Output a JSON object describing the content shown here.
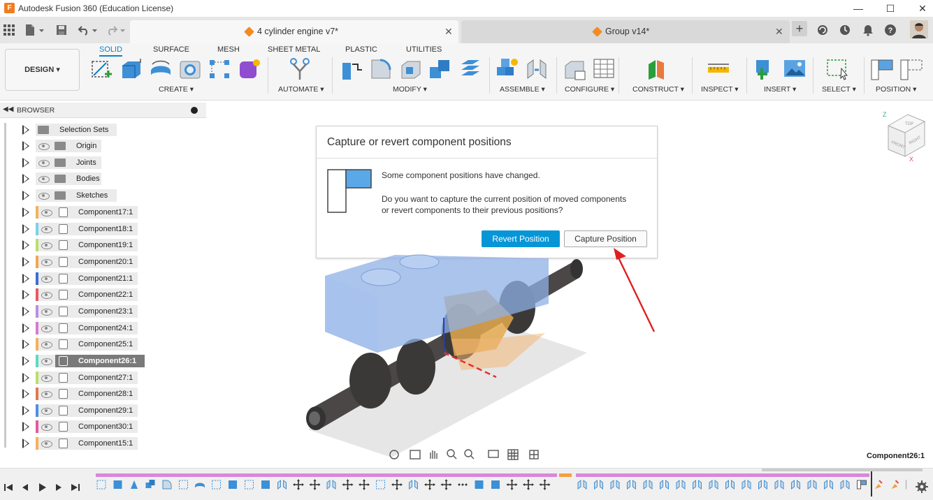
{
  "window": {
    "title": "Autodesk Fusion 360 (Education License)",
    "logo": "F"
  },
  "tabs": [
    {
      "label": "4 cylinder engine v7*",
      "active": true,
      "close": "✕"
    },
    {
      "label": "Group v14*",
      "active": false,
      "close": "✕"
    }
  ],
  "toolbar": {
    "workspace": "DESIGN",
    "modes": [
      "SOLID",
      "SURFACE",
      "MESH",
      "SHEET METAL",
      "PLASTIC",
      "UTILITIES"
    ],
    "active_mode": "SOLID",
    "groups": [
      "CREATE",
      "AUTOMATE",
      "MODIFY",
      "ASSEMBLE",
      "CONFIGURE",
      "CONSTRUCT",
      "INSPECT",
      "INSERT",
      "SELECT",
      "POSITION"
    ]
  },
  "browser": {
    "title": "BROWSER",
    "folders": [
      {
        "label": "Selection Sets",
        "eye": false
      },
      {
        "label": "Origin",
        "eye": true
      },
      {
        "label": "Joints",
        "eye": true
      },
      {
        "label": "Bodies",
        "eye": true
      },
      {
        "label": "Sketches",
        "eye": true
      }
    ],
    "components": [
      {
        "label": "Component17:1",
        "color": "#f2b25c"
      },
      {
        "label": "Component18:1",
        "color": "#7fd0e8"
      },
      {
        "label": "Component19:1",
        "color": "#b7e06a"
      },
      {
        "label": "Component20:1",
        "color": "#f2a654"
      },
      {
        "label": "Component21:1",
        "color": "#3a6fd1"
      },
      {
        "label": "Component22:1",
        "color": "#e8595f"
      },
      {
        "label": "Component23:1",
        "color": "#b98ee8"
      },
      {
        "label": "Component24:1",
        "color": "#d57ad5"
      },
      {
        "label": "Component25:1",
        "color": "#f2b25c"
      },
      {
        "label": "Component26:1",
        "color": "#5fd8c4",
        "selected": true
      },
      {
        "label": "Component27:1",
        "color": "#b7e06a"
      },
      {
        "label": "Component28:1",
        "color": "#e07a4f"
      },
      {
        "label": "Component29:1",
        "color": "#4e8fe0"
      },
      {
        "label": "Component30:1",
        "color": "#e25aa0"
      },
      {
        "label": "Component15:1",
        "color": "#f2b25c"
      }
    ]
  },
  "dialog": {
    "title": "Capture or revert component positions",
    "message_1": "Some component positions have changed.",
    "message_2": "Do you want to capture the current position of moved components",
    "message_3": "or revert components to their previous positions?",
    "revert_label": "Revert Position",
    "capture_label": "Capture Position"
  },
  "viewcube": {
    "top": "TOP",
    "front": "FRONT",
    "right": "RIGHT",
    "z": "Z",
    "x": "X"
  },
  "status": {
    "selected_component": "Component26:1"
  }
}
